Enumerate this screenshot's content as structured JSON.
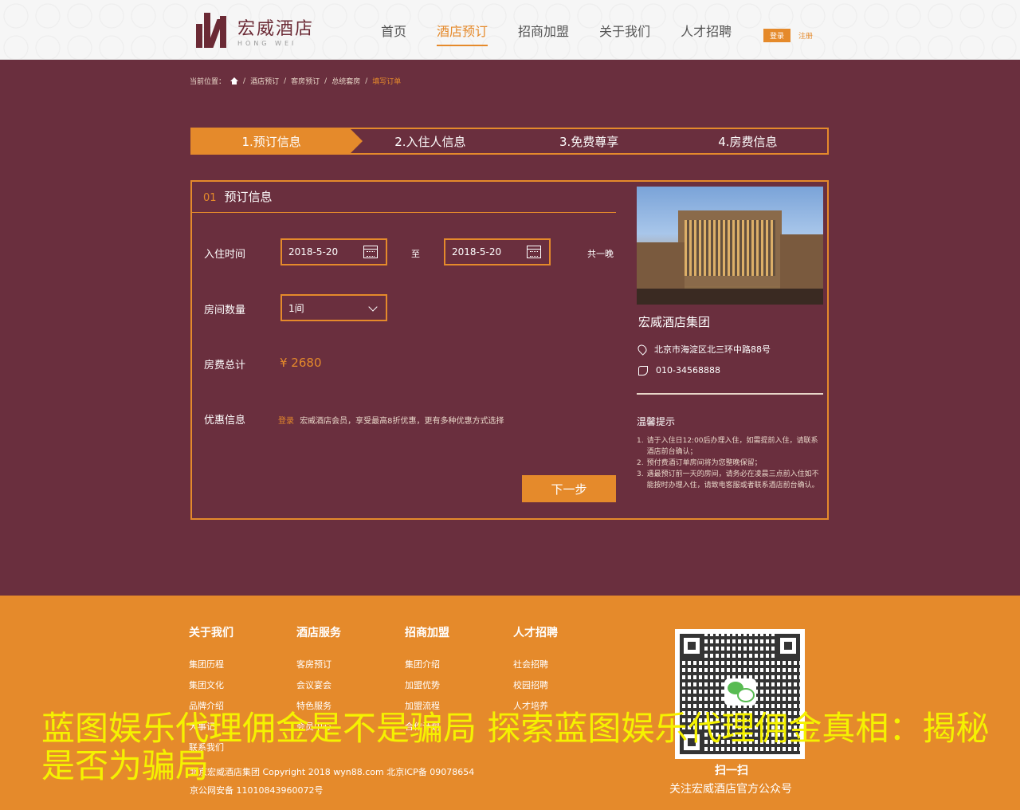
{
  "header": {
    "logo_cn": "宏威酒店",
    "logo_en": "HONG WEI",
    "nav": [
      "首页",
      "酒店预订",
      "招商加盟",
      "关于我们",
      "人才招聘"
    ],
    "login_label": "登录",
    "register_label": "注册"
  },
  "breadcrumb": {
    "prefix": "当前位置：",
    "items": [
      "酒店预订",
      "客房预订",
      "总统套房"
    ],
    "current": "填写订单"
  },
  "steps": [
    "1.预订信息",
    "2.入住人信息",
    "3.免费尊享",
    "4.房费信息"
  ],
  "form": {
    "section_num": "01",
    "section_title": "预订信息",
    "checkin_label": "入住时间",
    "checkin_date": "2018-5-20",
    "to_label": "至",
    "checkout_date": "2018-5-20",
    "nights": "共一晚",
    "rooms_label": "房间数量",
    "rooms_value": "1间",
    "total_label": "房费总计",
    "total_value": "¥ 2680",
    "promo_label": "优惠信息",
    "promo_link": "登录",
    "promo_text": "宏威酒店会员，享受最高8折优惠，更有多种优惠方式选择",
    "next_label": "下一步"
  },
  "hotel": {
    "name": "宏威酒店集团",
    "address": "北京市海淀区北三环中路88号",
    "phone": "010-34568888",
    "tips_title": "温馨提示",
    "tips": [
      {
        "n": "1.",
        "t": "请于入住日12:00后办理入住，如需提前入住，请联系酒店前台确认；"
      },
      {
        "n": "2.",
        "t": "预付费酒订单房间将为您整晚保留；"
      },
      {
        "n": "3.",
        "t": "遇最预订前一天的房间，请务必在凌晨三点前入住如不能按时办理入住，请致电客服或者联系酒店前台确认。"
      }
    ]
  },
  "footer": {
    "cols": [
      {
        "title": "关于我们",
        "items": [
          "集团历程",
          "集团文化",
          "品牌介绍",
          "大事记",
          "联系我们"
        ]
      },
      {
        "title": "酒店服务",
        "items": [
          "客房预订",
          "会议宴会",
          "特色服务",
          "会员中心"
        ]
      },
      {
        "title": "招商加盟",
        "items": [
          "集团介绍",
          "加盟优势",
          "加盟流程",
          "合作计划"
        ]
      },
      {
        "title": "人才招聘",
        "items": [
          "社会招聘",
          "校园招聘",
          "人才培养"
        ]
      }
    ],
    "copyright": "北京宏威酒店集团  Copyright 2018  wyn88.com  北京ICP备 09078654",
    "police": "京公网安备 11010843960072号",
    "scan_label": "扫一扫",
    "follow_label": "关注宏威酒店官方公众号"
  },
  "overlay_text": "蓝图娱乐代理佣金是不是骗局 探索蓝图娱乐代理佣金真相：揭秘是否为骗局",
  "colors": {
    "accent": "#e58a2b",
    "bg": "#6a2f3e",
    "overlay": "#f5f200"
  }
}
